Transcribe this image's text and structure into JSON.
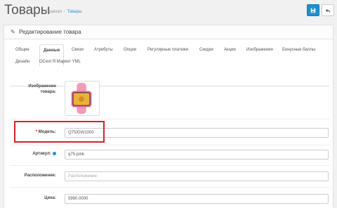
{
  "header": {
    "title": "Товары",
    "breadcrumb": [
      "Главная",
      "Товары"
    ]
  },
  "panel": {
    "title": "Редактирование товара"
  },
  "tabs": [
    {
      "label": "Общие"
    },
    {
      "label": "Данные",
      "active": true
    },
    {
      "label": "Связи"
    },
    {
      "label": "Атрибуты"
    },
    {
      "label": "Опции"
    },
    {
      "label": "Регулярные платежи"
    },
    {
      "label": "Скидки"
    },
    {
      "label": "Акции"
    },
    {
      "label": "Изображения"
    },
    {
      "label": "Бонусные баллы"
    },
    {
      "label": "Дизайн"
    },
    {
      "label": "OCext Я.Маркет YML"
    }
  ],
  "form": {
    "image_label": "Изображение товара:",
    "model": {
      "label": "Модель:",
      "value": "Q75/GW1000"
    },
    "sku": {
      "label": "Артикул:",
      "value": "q75-pink"
    },
    "location": {
      "label": "Расположение:",
      "placeholder": "Расположение:"
    },
    "price": {
      "label": "Цена:",
      "value": "5990.0000"
    }
  },
  "colors": {
    "primary": "#1e91cf",
    "highlight": "#d9212b"
  },
  "icons": {
    "save": "save-icon",
    "back": "reply-icon",
    "edit": "pencil-icon"
  }
}
